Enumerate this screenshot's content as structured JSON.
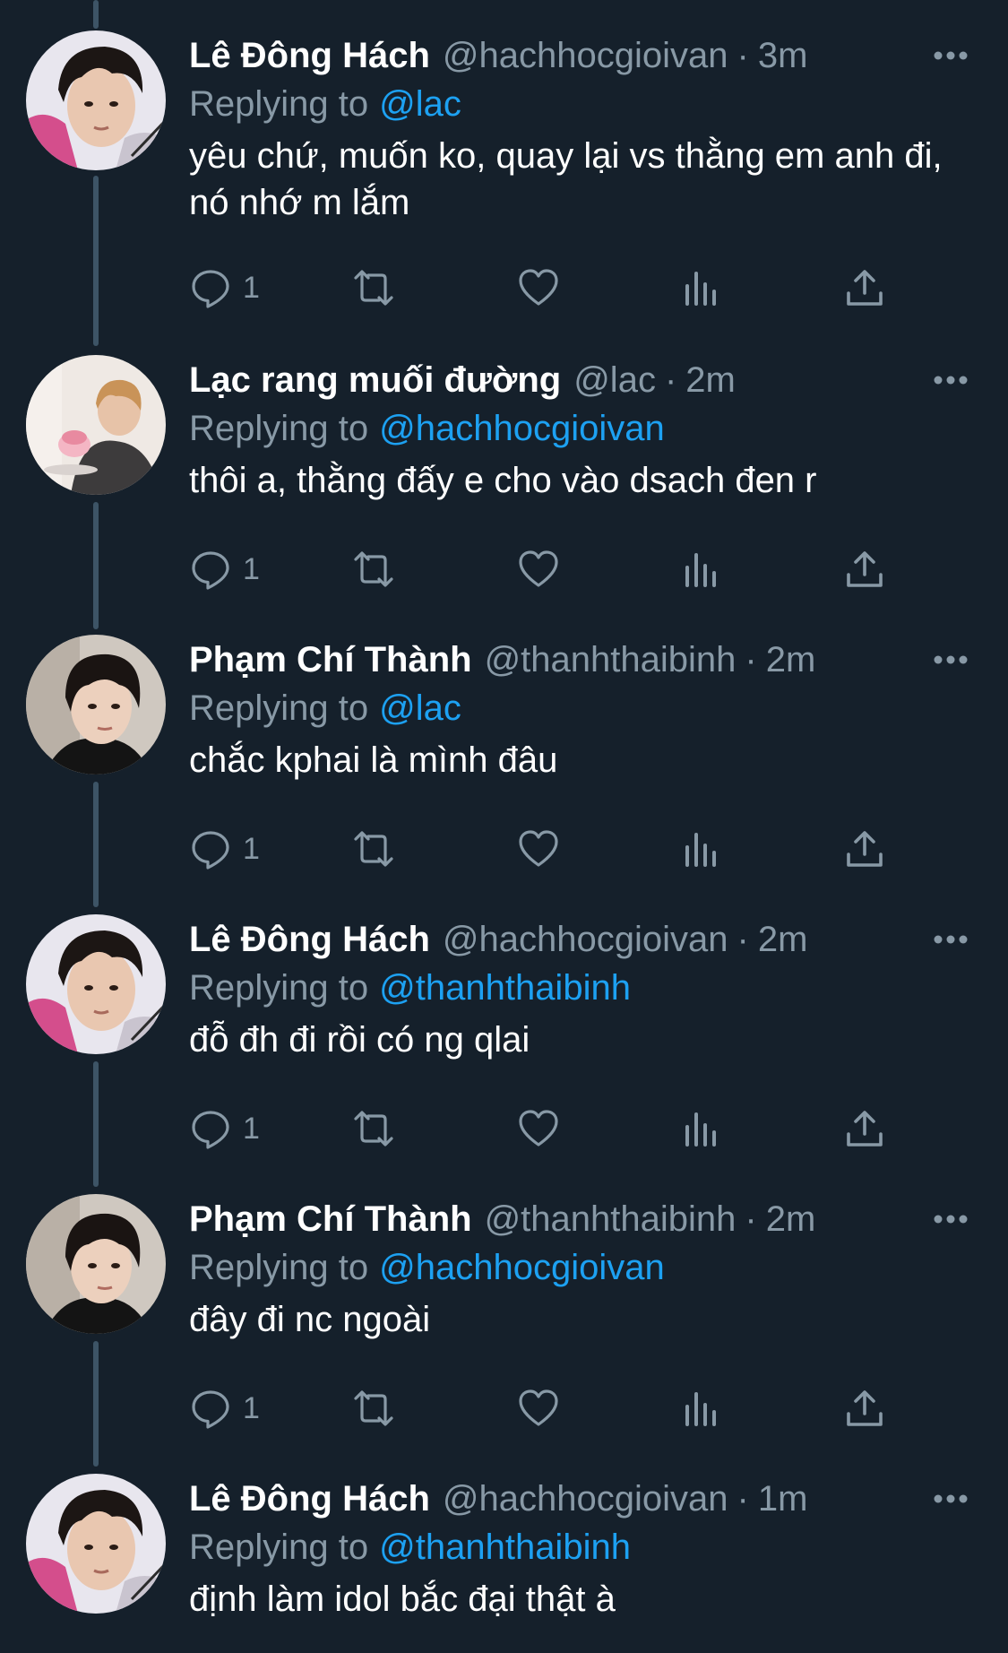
{
  "tweets": [
    {
      "name": "Lê Đông Hách",
      "handle": "@hachhocgioivan",
      "separator": "·",
      "time": "3m",
      "replying_prefix": "Replying to",
      "replying_to": "@lac",
      "text": "yêu chứ, muốn ko, quay lại vs thằng em anh đi, nó nhớ m lắm",
      "reply_count": "1",
      "avatar_icon": "avatar-boy-pink-hoodie"
    },
    {
      "name": "Lạc rang muối đường",
      "handle": "@lac",
      "separator": "·",
      "time": "2m",
      "replying_prefix": "Replying to",
      "replying_to": "@hachhocgioivan",
      "text": "thôi a, thằng đấy e cho vào dsach đen r",
      "reply_count": "1",
      "avatar_icon": "avatar-boy-with-cake"
    },
    {
      "name": "Phạm Chí Thành",
      "handle": "@thanhthaibinh",
      "separator": "·",
      "time": "2m",
      "replying_prefix": "Replying to",
      "replying_to": "@lac",
      "text": "chắc kphai là mình đâu",
      "reply_count": "1",
      "avatar_icon": "avatar-boy-dark-hair"
    },
    {
      "name": "Lê Đông Hách",
      "handle": "@hachhocgioivan",
      "separator": "·",
      "time": "2m",
      "replying_prefix": "Replying to",
      "replying_to": "@thanhthaibinh",
      "text": "đỗ đh đi rồi có ng qlai",
      "reply_count": "1",
      "avatar_icon": "avatar-boy-pink-hoodie"
    },
    {
      "name": "Phạm Chí Thành",
      "handle": "@thanhthaibinh",
      "separator": "·",
      "time": "2m",
      "replying_prefix": "Replying to",
      "replying_to": "@hachhocgioivan",
      "text": "đây đi nc ngoài",
      "reply_count": "1",
      "avatar_icon": "avatar-boy-dark-hair"
    },
    {
      "name": "Lê Đông Hách",
      "handle": "@hachhocgioivan",
      "separator": "·",
      "time": "1m",
      "replying_prefix": "Replying to",
      "replying_to": "@thanhthaibinh",
      "text": "định làm idol bắc đại thật à",
      "reply_count": "",
      "avatar_icon": "avatar-boy-pink-hoodie"
    }
  ],
  "icons": {
    "reply": "reply-icon",
    "retweet": "retweet-icon",
    "like": "heart-icon",
    "analytics": "analytics-icon",
    "share": "share-icon",
    "more": "more-icon"
  },
  "colors": {
    "background": "#15202b",
    "text": "#ffffff",
    "muted": "#8899a6",
    "link": "#1da1f2",
    "thread_line": "#3d5466"
  }
}
